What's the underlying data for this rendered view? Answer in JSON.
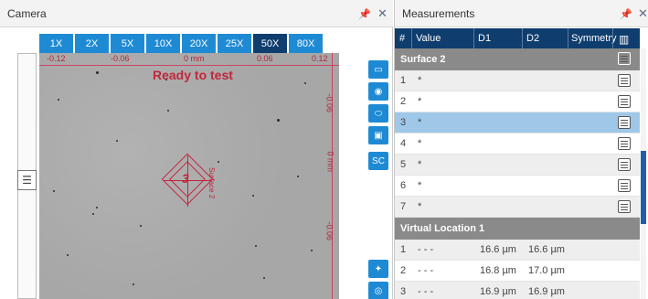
{
  "camera": {
    "title": "Camera",
    "pin_icon": "pin-icon",
    "close_icon": "close-icon",
    "magnifications": [
      {
        "label": "1X",
        "active": false
      },
      {
        "label": "2X",
        "active": false
      },
      {
        "label": "5X",
        "active": false
      },
      {
        "label": "10X",
        "active": false
      },
      {
        "label": "20X",
        "active": false
      },
      {
        "label": "25X",
        "active": false
      },
      {
        "label": "50X",
        "active": true
      },
      {
        "label": "80X",
        "active": false
      }
    ],
    "ruler_top": [
      "-0.12",
      "-0.06",
      "0 mm",
      "0.06",
      "0.12"
    ],
    "ruler_right": [
      "-0.06",
      "0 mm",
      "-0.06"
    ],
    "status_text": "Ready to test",
    "indent_number": "3",
    "indent_label": "Surface 2",
    "tools": [
      {
        "icon": "ruler-icon",
        "glyph": "▭"
      },
      {
        "icon": "camera-capture-icon",
        "glyph": "◉"
      },
      {
        "icon": "surface-shape-icon",
        "glyph": "⬭"
      },
      {
        "icon": "image-stack-icon",
        "glyph": "▣"
      },
      {
        "icon": "sc-icon",
        "glyph": "SC"
      },
      {
        "icon": "light-icon",
        "glyph": "✦"
      },
      {
        "icon": "target-icon",
        "glyph": "◎"
      }
    ],
    "accent_color": "#1f8ad4",
    "active_color": "#0f3d6e",
    "overlay_color": "#c2263b"
  },
  "measurements": {
    "title": "Measurements",
    "columns": [
      "#",
      "Value",
      "D1",
      "D2",
      "Symmetry"
    ],
    "column_icon": "columns-icon",
    "groups": [
      {
        "label": "Surface 2",
        "rows": [
          {
            "n": "1",
            "value": "*",
            "d1": "",
            "d2": ""
          },
          {
            "n": "2",
            "value": "*",
            "d1": "",
            "d2": ""
          },
          {
            "n": "3",
            "value": "*",
            "d1": "",
            "d2": "",
            "selected": true
          },
          {
            "n": "4",
            "value": "*",
            "d1": "",
            "d2": ""
          },
          {
            "n": "5",
            "value": "*",
            "d1": "",
            "d2": ""
          },
          {
            "n": "6",
            "value": "*",
            "d1": "",
            "d2": ""
          },
          {
            "n": "7",
            "value": "*",
            "d1": "",
            "d2": ""
          }
        ]
      },
      {
        "label": "Virtual Location 1",
        "rows": [
          {
            "n": "1",
            "value": "- - -",
            "d1": "16.6 µm",
            "d2": "16.6 µm"
          },
          {
            "n": "2",
            "value": "- - -",
            "d1": "16.8 µm",
            "d2": "17.0 µm"
          },
          {
            "n": "3",
            "value": "- - -",
            "d1": "16.9 µm",
            "d2": "16.9 µm"
          }
        ]
      }
    ]
  }
}
